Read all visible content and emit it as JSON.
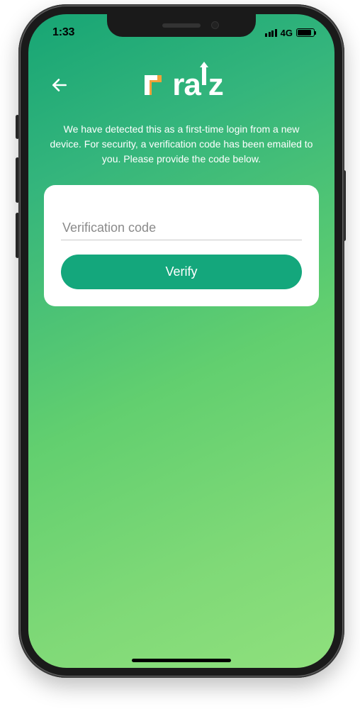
{
  "status": {
    "time": "1:33",
    "network": "4G"
  },
  "logo": {
    "brand": "raiz"
  },
  "message": "We have detected this as a first-time login from a new device. For security, a verification code has been emailed to you. Please provide the code below.",
  "form": {
    "placeholder": "Verification code",
    "submit_label": "Verify"
  },
  "colors": {
    "primary": "#14a77c",
    "gradient_start": "#17a574",
    "gradient_end": "#8fe07d"
  }
}
